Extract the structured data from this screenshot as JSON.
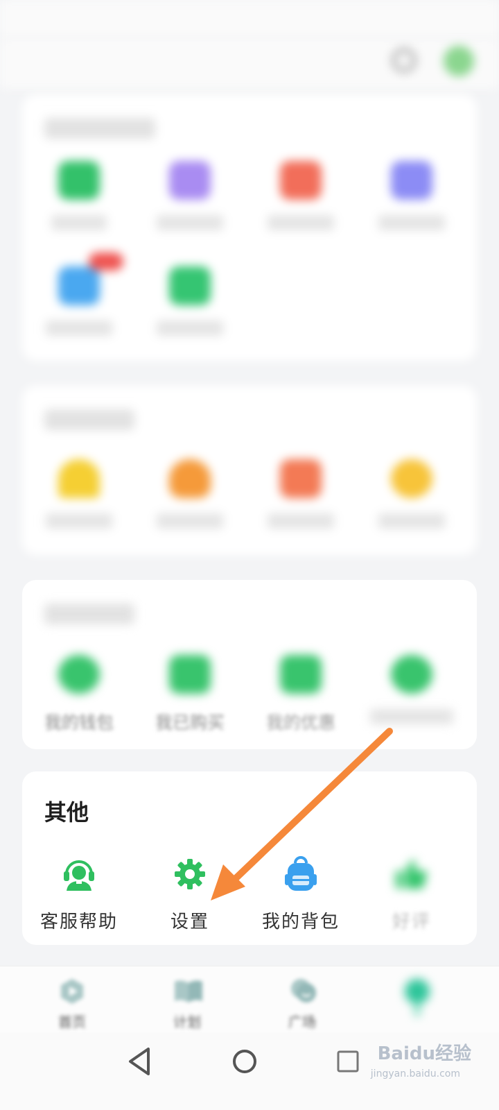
{
  "status_bar": {
    "left": "",
    "right": ""
  },
  "header": {
    "title": ""
  },
  "sections": {
    "learning": {
      "title": "",
      "items": [
        {
          "label": "",
          "color": "#33c16a"
        },
        {
          "label": "",
          "color": "#a98cf2"
        },
        {
          "label": "",
          "color": "#f26e5a"
        },
        {
          "label": "",
          "color": "#8c8cf5"
        },
        {
          "label": "",
          "color": "#4aa8f0",
          "badge": true
        },
        {
          "label": "",
          "color": "#35c572"
        }
      ]
    },
    "activity": {
      "title": "",
      "items": [
        {
          "label": "",
          "color": "#f5cf33"
        },
        {
          "label": "",
          "color": "#f59a3a"
        },
        {
          "label": "",
          "color": "#f37a55"
        },
        {
          "label": "",
          "color": "#f7c43a"
        }
      ]
    },
    "service": {
      "title": "",
      "items": [
        {
          "label": "我的钱包",
          "color": "#39c46d"
        },
        {
          "label": "我已购买",
          "color": "#39c46d"
        },
        {
          "label": "我的优惠",
          "color": "#39c46d"
        },
        {
          "label": "",
          "color": "#39c46d"
        }
      ]
    },
    "other": {
      "title": "其他",
      "items": [
        {
          "label": "客服帮助",
          "icon": "headset-icon",
          "color": "#2fbf5f"
        },
        {
          "label": "设置",
          "icon": "gear-icon",
          "color": "#2fbf5f"
        },
        {
          "label": "我的背包",
          "icon": "backpack-icon",
          "color": "#3aa0ee"
        },
        {
          "label": "好评",
          "icon": "thumbs-up-icon",
          "color": "#34c56c"
        }
      ]
    }
  },
  "bottom_nav": [
    {
      "label": "首页",
      "icon": "play-icon"
    },
    {
      "label": "计划",
      "icon": "book-icon"
    },
    {
      "label": "广场",
      "icon": "chat-bubble-icon"
    },
    {
      "label": "",
      "icon": "mascot-icon"
    }
  ],
  "watermark": {
    "text": "Baidu经验",
    "sub": "jingyan.baidu.com"
  },
  "colors": {
    "accent_green": "#2fbf5f",
    "arrow": "#f5883a"
  }
}
